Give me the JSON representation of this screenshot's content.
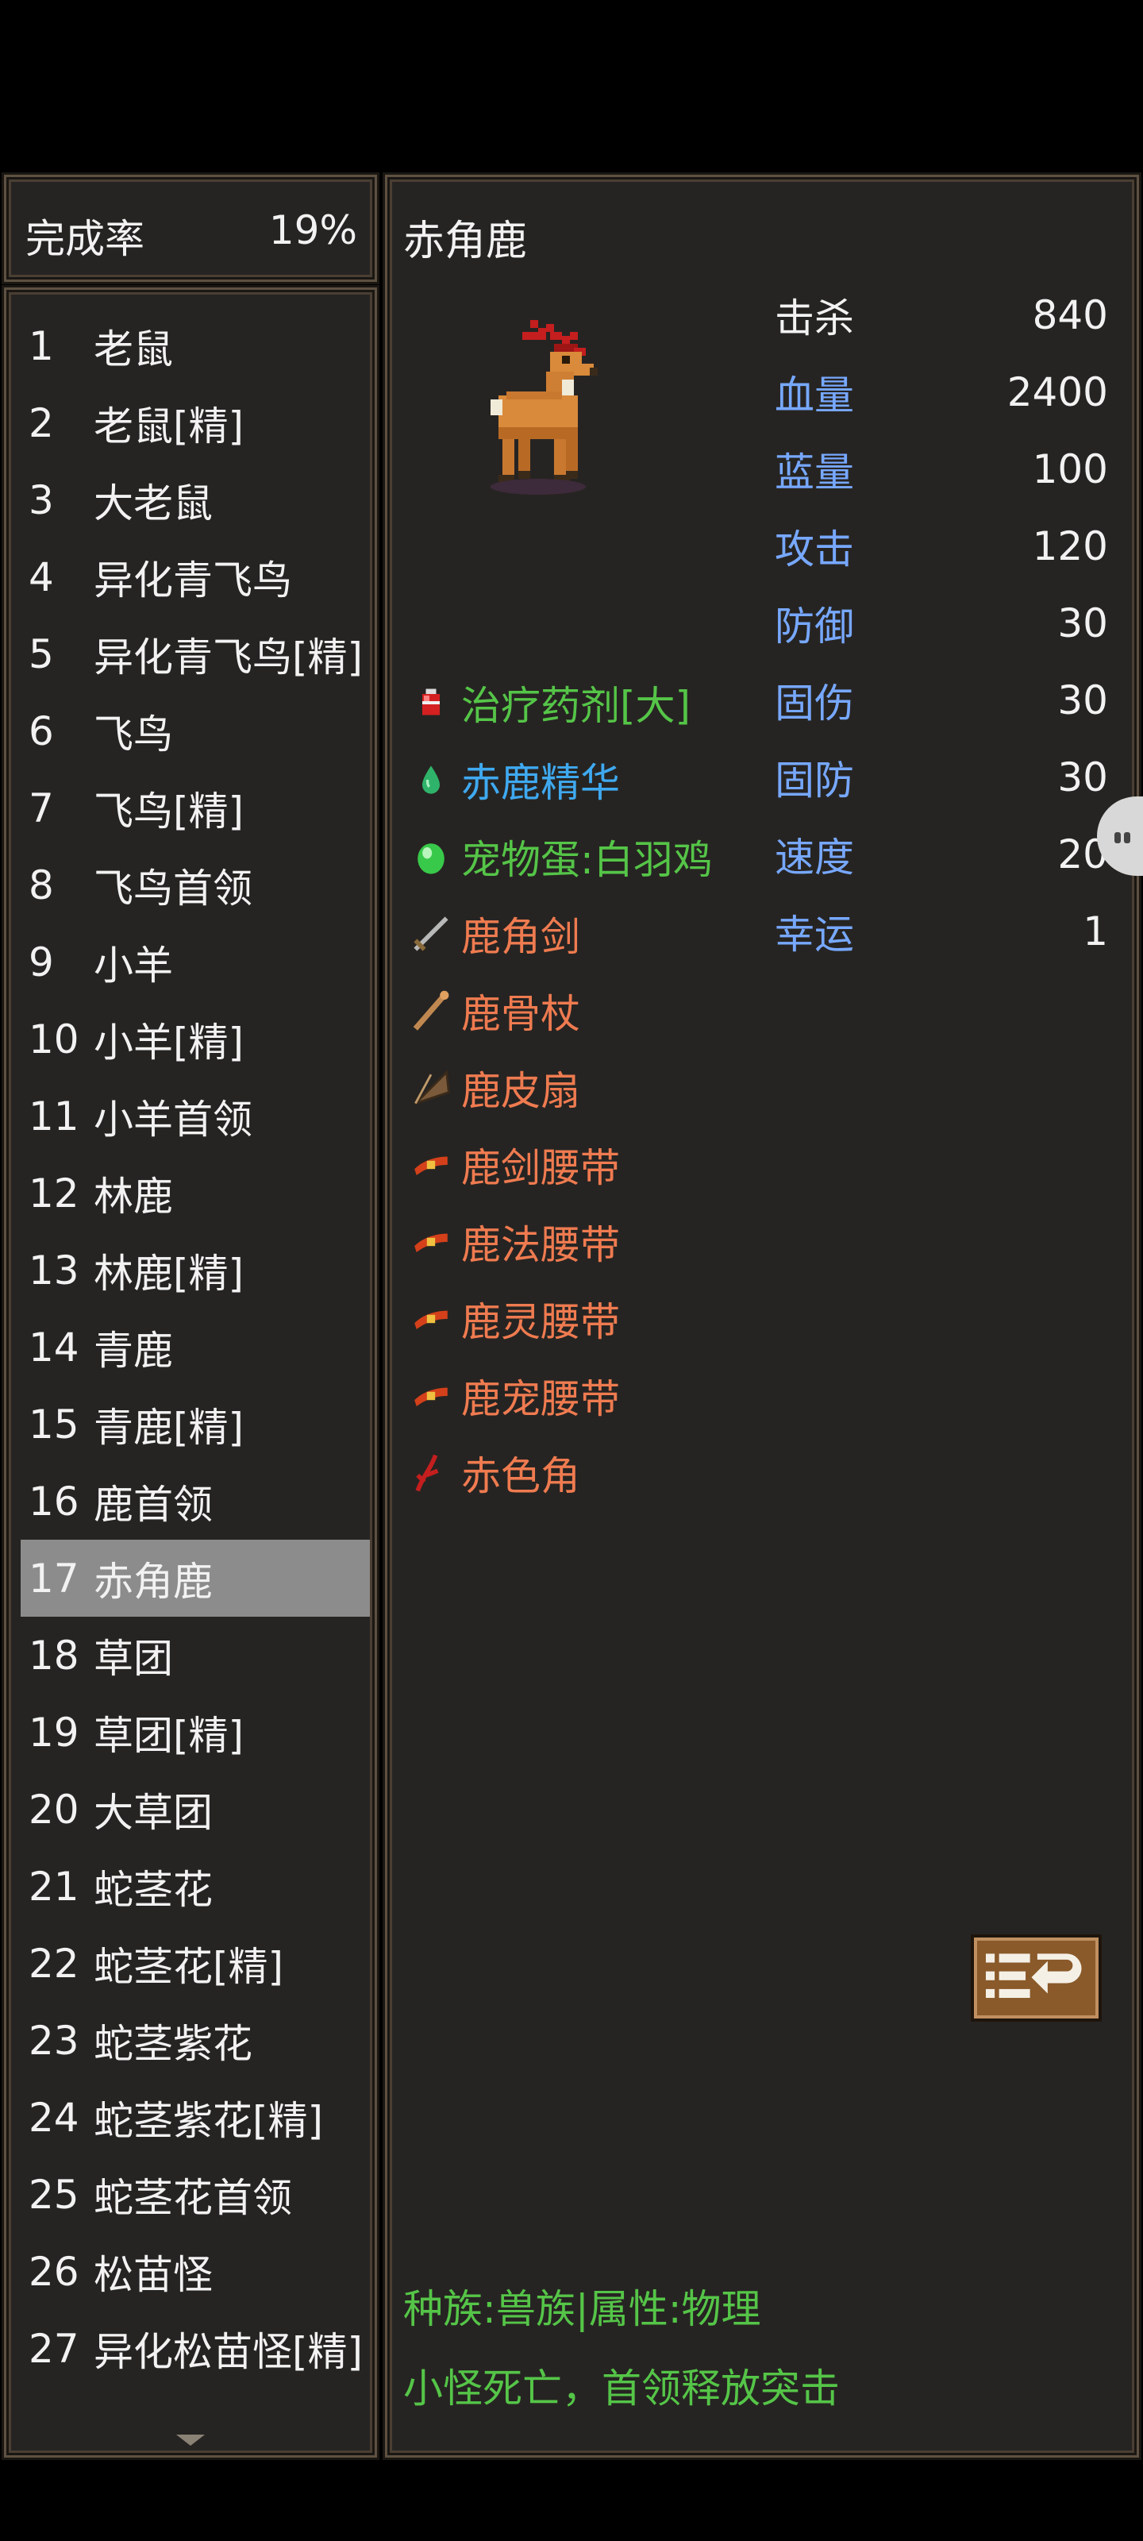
{
  "completion": {
    "label": "完成率",
    "value": "19%"
  },
  "mob_list": {
    "items": [
      {
        "num": "1",
        "name": "老鼠"
      },
      {
        "num": "2",
        "name": "老鼠[精]"
      },
      {
        "num": "3",
        "name": "大老鼠"
      },
      {
        "num": "4",
        "name": "异化青飞鸟"
      },
      {
        "num": "5",
        "name": "异化青飞鸟[精]"
      },
      {
        "num": "6",
        "name": "飞鸟"
      },
      {
        "num": "7",
        "name": "飞鸟[精]"
      },
      {
        "num": "8",
        "name": "飞鸟首领"
      },
      {
        "num": "9",
        "name": "小羊"
      },
      {
        "num": "10",
        "name": "小羊[精]"
      },
      {
        "num": "11",
        "name": "小羊首领"
      },
      {
        "num": "12",
        "name": "林鹿"
      },
      {
        "num": "13",
        "name": "林鹿[精]"
      },
      {
        "num": "14",
        "name": "青鹿"
      },
      {
        "num": "15",
        "name": "青鹿[精]"
      },
      {
        "num": "16",
        "name": "鹿首领"
      },
      {
        "num": "17",
        "name": "赤角鹿"
      },
      {
        "num": "18",
        "name": "草团"
      },
      {
        "num": "19",
        "name": "草团[精]"
      },
      {
        "num": "20",
        "name": "大草团"
      },
      {
        "num": "21",
        "name": "蛇茎花"
      },
      {
        "num": "22",
        "name": "蛇茎花[精]"
      },
      {
        "num": "23",
        "name": "蛇茎紫花"
      },
      {
        "num": "24",
        "name": "蛇茎紫花[精]"
      },
      {
        "num": "25",
        "name": "蛇茎花首领"
      },
      {
        "num": "26",
        "name": "松苗怪"
      },
      {
        "num": "27",
        "name": "异化松苗怪[精]"
      }
    ],
    "selected": "17"
  },
  "detail": {
    "title": "赤角鹿",
    "stats": [
      {
        "label": "击杀",
        "value": "840",
        "color": "white"
      },
      {
        "label": "血量",
        "value": "2400",
        "color": "blue"
      },
      {
        "label": "蓝量",
        "value": "100",
        "color": "blue"
      },
      {
        "label": "攻击",
        "value": "120",
        "color": "blue"
      },
      {
        "label": "防御",
        "value": "30",
        "color": "blue"
      },
      {
        "label": "固伤",
        "value": "30",
        "color": "blue"
      },
      {
        "label": "固防",
        "value": "30",
        "color": "blue"
      },
      {
        "label": "速度",
        "value": "20",
        "color": "blue"
      },
      {
        "label": "幸运",
        "value": "1",
        "color": "blue"
      }
    ],
    "drops": [
      {
        "name": "治疗药剂[大]",
        "color": "#55c548",
        "icon": "potion-icon"
      },
      {
        "name": "赤鹿精华",
        "color": "#3fa9f0",
        "icon": "essence-icon"
      },
      {
        "name": "宠物蛋:白羽鸡",
        "color": "#55c548",
        "icon": "egg-icon"
      },
      {
        "name": "鹿角剑",
        "color": "#ef7b50",
        "icon": "sword-icon"
      },
      {
        "name": "鹿骨杖",
        "color": "#ef7b50",
        "icon": "staff-icon"
      },
      {
        "name": "鹿皮扇",
        "color": "#ef7b50",
        "icon": "fan-icon"
      },
      {
        "name": "鹿剑腰带",
        "color": "#ef7b50",
        "icon": "belt-icon"
      },
      {
        "name": "鹿法腰带",
        "color": "#ef7b50",
        "icon": "belt-icon"
      },
      {
        "name": "鹿灵腰带",
        "color": "#ef7b50",
        "icon": "belt-icon"
      },
      {
        "name": "鹿宠腰带",
        "color": "#ef7b50",
        "icon": "belt-icon"
      },
      {
        "name": "赤色角",
        "color": "#ef7b50",
        "icon": "horn-icon"
      }
    ],
    "footer": {
      "line1": "种族:兽族|属性:物理",
      "line2": "小怪死亡，首领释放突击"
    }
  },
  "colors": {
    "panel_bg": "#262422",
    "panel_border": "#5e5141",
    "stat_blue": "#77a8ff",
    "drop_green": "#55c548",
    "drop_cyan": "#3fa9f0",
    "drop_orange": "#ef7b50",
    "selected_bg": "#8c8c8c"
  }
}
